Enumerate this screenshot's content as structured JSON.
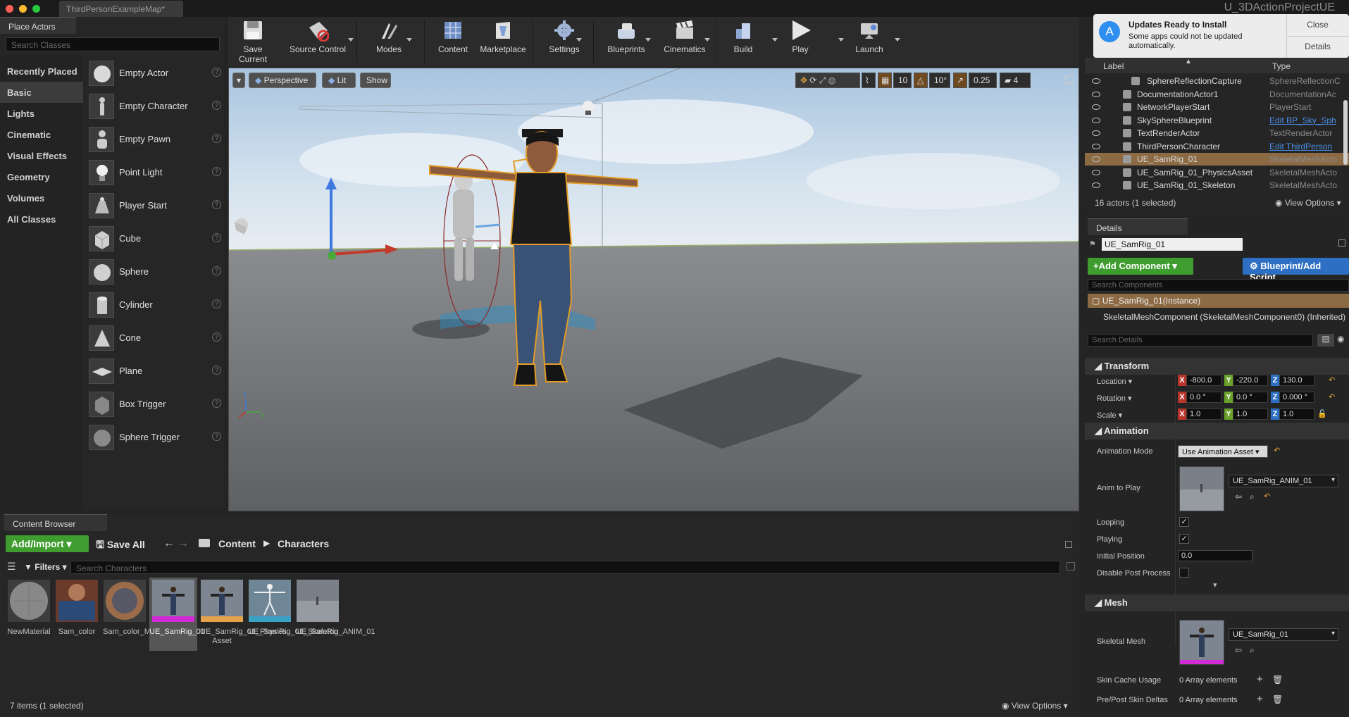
{
  "window": {
    "doc_tab": "ThirdPersonExampleMap*",
    "project": "U_3DActionProjectUE"
  },
  "place_actors": {
    "tab": "Place Actors",
    "search_placeholder": "Search Classes",
    "categories": [
      "Recently Placed",
      "Basic",
      "Lights",
      "Cinematic",
      "Visual Effects",
      "Geometry",
      "Volumes",
      "All Classes"
    ],
    "active_category": "Basic",
    "actors": [
      "Empty Actor",
      "Empty Character",
      "Empty Pawn",
      "Point Light",
      "Player Start",
      "Cube",
      "Sphere",
      "Cylinder",
      "Cone",
      "Plane",
      "Box Trigger",
      "Sphere Trigger"
    ]
  },
  "toolbar": {
    "items": [
      "Save Current",
      "Source Control",
      "Modes",
      "Content",
      "Marketplace",
      "Settings",
      "Blueprints",
      "Cinematics",
      "Build",
      "Play",
      "Launch"
    ]
  },
  "viewport": {
    "perspective": "Perspective",
    "lit": "Lit",
    "show": "Show",
    "grid_snap": "10",
    "rot_snap": "10°",
    "scale_snap": "0.25",
    "cam_speed": "4"
  },
  "content_browser": {
    "tab": "Content Browser",
    "add_import": "Add/Import",
    "save_all": "Save All",
    "path": [
      "Content",
      "Characters"
    ],
    "filters": "Filters",
    "search_placeholder": "Search Characters",
    "assets": [
      {
        "label": "NewMaterial",
        "bar": ""
      },
      {
        "label": "Sam_color",
        "bar": ""
      },
      {
        "label": "Sam_color_Mat",
        "bar": ""
      },
      {
        "label": "UE_SamRig_01",
        "bar": "#d22bd6"
      },
      {
        "label": "UE_SamRig_01_Physics Asset",
        "bar": "#e4a24b"
      },
      {
        "label": "UE_SamRig_01_Skeleton",
        "bar": "#3aa0c4"
      },
      {
        "label": "UE_SamRig_ANIM_01",
        "bar": ""
      }
    ],
    "status": "7 items (1 selected)",
    "view_options": "View Options"
  },
  "notification": {
    "title": "Updates Ready to Install",
    "body": "Some apps could not be updated automatically.",
    "close": "Close",
    "details": "Details"
  },
  "outliner": {
    "col_label": "Label",
    "col_type": "Type",
    "rows": [
      {
        "label": "SphereReflectionCapture",
        "type": "SphereReflectionC",
        "link": false,
        "selected": false,
        "indent": true
      },
      {
        "label": "DocumentationActor1",
        "type": "DocumentationAc",
        "link": false,
        "selected": false,
        "indent": false
      },
      {
        "label": "NetworkPlayerStart",
        "type": "PlayerStart",
        "link": false,
        "selected": false,
        "indent": false
      },
      {
        "label": "SkySphereBlueprint",
        "type": "Edit BP_Sky_Sph",
        "link": true,
        "selected": false,
        "indent": false
      },
      {
        "label": "TextRenderActor",
        "type": "TextRenderActor",
        "link": false,
        "selected": false,
        "indent": false
      },
      {
        "label": "ThirdPersonCharacter",
        "type": "Edit ThirdPerson",
        "link": true,
        "selected": false,
        "indent": false
      },
      {
        "label": "UE_SamRig_01",
        "type": "SkeletalMeshActo",
        "link": false,
        "selected": true,
        "indent": false
      },
      {
        "label": "UE_SamRig_01_PhysicsAsset",
        "type": "SkeletalMeshActo",
        "link": false,
        "selected": false,
        "indent": false
      },
      {
        "label": "UE_SamRig_01_Skeleton",
        "type": "SkeletalMeshActo",
        "link": false,
        "selected": false,
        "indent": false
      }
    ],
    "status": "16 actors (1 selected)",
    "view_options": "View Options"
  },
  "details": {
    "tab": "Details",
    "name": "UE_SamRig_01",
    "add_component": "+Add Component",
    "blueprint_script": "Blueprint/Add Script",
    "search_components": "Search Components",
    "instance": "UE_SamRig_01(Instance)",
    "component": "SkeletalMeshComponent (SkeletalMeshComponent0) (Inherited)",
    "search_details": "Search Details",
    "transform": {
      "title": "Transform",
      "location_label": "Location",
      "rotation_label": "Rotation",
      "scale_label": "Scale",
      "location": [
        "-800.0",
        "-220.0",
        "130.0"
      ],
      "rotation": [
        "0.0 °",
        "0.0 °",
        "0.000 °"
      ],
      "scale": [
        "1.0",
        "1.0",
        "1.0"
      ]
    },
    "animation": {
      "title": "Animation",
      "mode_label": "Animation Mode",
      "mode_value": "Use Animation Asset",
      "anim_label": "Anim to Play",
      "anim_value": "UE_SamRig_ANIM_01",
      "looping_label": "Looping",
      "playing_label": "Playing",
      "initial_label": "Initial Position",
      "initial_value": "0.0",
      "disable_label": "Disable Post Process",
      "looping": true,
      "playing": true,
      "disable_post": false
    },
    "mesh": {
      "title": "Mesh",
      "skeletal_label": "Skeletal Mesh",
      "skeletal_value": "UE_SamRig_01",
      "skin_label": "Skin Cache Usage",
      "skin_value": "0 Array elements",
      "prepost_label": "Pre/Post Skin Deltas",
      "prepost_value": "0 Array elements"
    }
  },
  "colors": {
    "selection": "#8c6a44",
    "green": "#3f9d2f",
    "blue": "#2d6fc2",
    "accent_orange": "#e29b28"
  }
}
